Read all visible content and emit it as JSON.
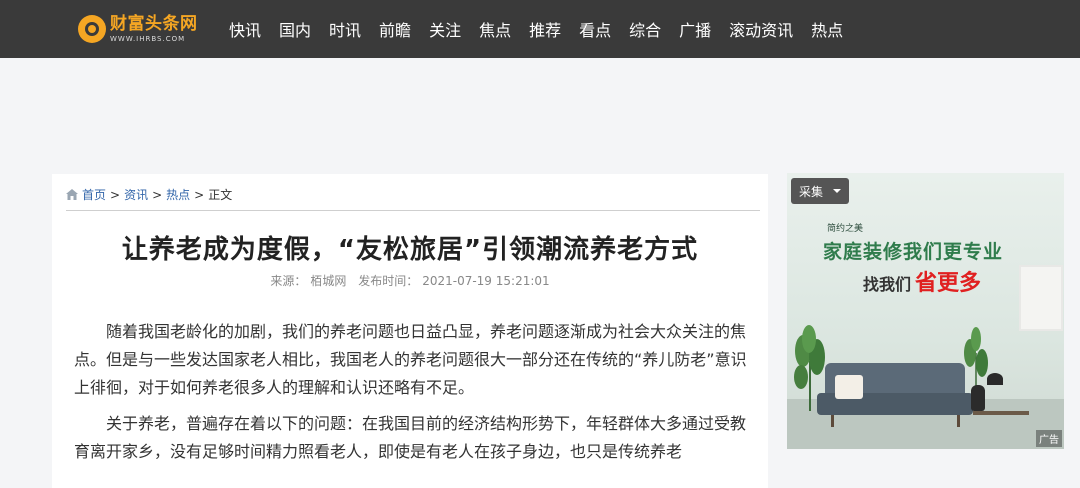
{
  "header": {
    "logo_text": "财富头条网",
    "logo_sub": "WWW.IHRBS.COM",
    "nav": [
      "快讯",
      "国内",
      "时讯",
      "前瞻",
      "关注",
      "焦点",
      "推荐",
      "看点",
      "综合",
      "广播",
      "滚动资讯",
      "热点"
    ]
  },
  "breadcrumb": {
    "items": [
      "首页",
      "资讯",
      "热点"
    ],
    "current": "正文",
    "separator": ">"
  },
  "article": {
    "title": "让养老成为度假，“友松旅居”引领潮流养老方式",
    "source_label": "来源：",
    "source": "栢城网",
    "time_label": "发布时间：",
    "time": "2021-07-19 15:21:01",
    "paragraphs": [
      "随着我国老龄化的加剧，我们的养老问题也日益凸显，养老问题逐渐成为社会大众关注的焦点。但是与一些发达国家老人相比，我国老人的养老问题很大一部分还在传统的“养儿防老”意识上徘徊，对于如何养老很多人的理解和认识还略有不足。",
      "关于养老，普遍存在着以下的问题：在我国目前的经济结构形势下，年轻群体大多通过受教育离开家乡，没有足够时间精力照看老人，即使是有老人在孩子身边，也只是传统养老"
    ]
  },
  "ad": {
    "collect_label": "采集",
    "small_text": "简约之美",
    "headline": "家庭装修我们更专业",
    "sub_prefix": "找我们",
    "sub_highlight": "省更多",
    "ad_badge": "广告"
  },
  "colors": {
    "topbar": "#3a3a3a",
    "logo": "#f5a623",
    "link": "#3366aa",
    "ad_green": "#2f7c4c",
    "ad_red": "#e02020"
  }
}
